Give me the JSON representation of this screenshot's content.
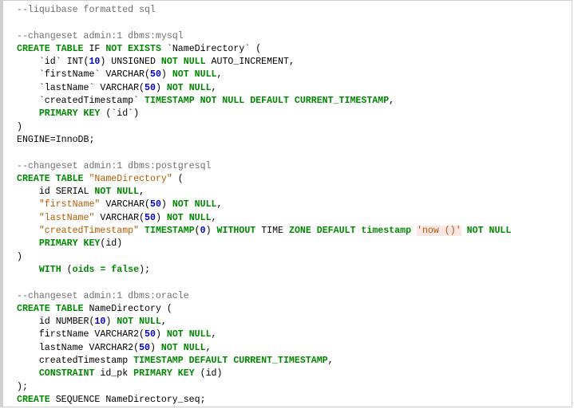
{
  "colors": {
    "keyword": "#008800",
    "comment": "#707070",
    "number": "#0000cc",
    "string": "#b35a00",
    "string_background": "#fbe5e5",
    "plain": "#000000",
    "frame_border": "#cfcfcf"
  },
  "code_lines": [
    [
      {
        "t": "--liquibase formatted sql",
        "k": "cm"
      }
    ],
    [],
    [
      {
        "t": "--changeset admin:1 dbms:mysql",
        "k": "cm"
      }
    ],
    [
      {
        "t": "CREATE TABLE",
        "k": "kw"
      },
      {
        "t": " IF ",
        "k": "pl"
      },
      {
        "t": "NOT EXISTS",
        "k": "kw"
      },
      {
        "t": " `NameDirectory` (",
        "k": "pl"
      }
    ],
    [
      {
        "t": "    `id` INT(",
        "k": "pl"
      },
      {
        "t": "10",
        "k": "num"
      },
      {
        "t": ") UNSIGNED ",
        "k": "pl"
      },
      {
        "t": "NOT NULL",
        "k": "kw"
      },
      {
        "t": " AUTO_INCREMENT,",
        "k": "pl"
      }
    ],
    [
      {
        "t": "    `firstName` VARCHAR(",
        "k": "pl"
      },
      {
        "t": "50",
        "k": "num"
      },
      {
        "t": ") ",
        "k": "pl"
      },
      {
        "t": "NOT NULL",
        "k": "kw"
      },
      {
        "t": ",",
        "k": "pl"
      }
    ],
    [
      {
        "t": "    `lastName` VARCHAR(",
        "k": "pl"
      },
      {
        "t": "50",
        "k": "num"
      },
      {
        "t": ") ",
        "k": "pl"
      },
      {
        "t": "NOT NULL",
        "k": "kw"
      },
      {
        "t": ",",
        "k": "pl"
      }
    ],
    [
      {
        "t": "    `createdTimestamp` ",
        "k": "pl"
      },
      {
        "t": "TIMESTAMP NOT NULL DEFAULT CURRENT_TIMESTAMP",
        "k": "kw"
      },
      {
        "t": ",",
        "k": "pl"
      }
    ],
    [
      {
        "t": "    ",
        "k": "pl"
      },
      {
        "t": "PRIMARY KEY",
        "k": "kw"
      },
      {
        "t": " (`id`)",
        "k": "pl"
      }
    ],
    [
      {
        "t": ")",
        "k": "pl"
      }
    ],
    [
      {
        "t": "ENGINE=InnoDB;",
        "k": "pl"
      }
    ],
    [],
    [
      {
        "t": "--changeset admin:1 dbms:postgresql",
        "k": "cm"
      }
    ],
    [
      {
        "t": "CREATE TABLE",
        "k": "kw"
      },
      {
        "t": " ",
        "k": "pl"
      },
      {
        "t": "\"NameDirectory\"",
        "k": "str"
      },
      {
        "t": " (",
        "k": "pl"
      }
    ],
    [
      {
        "t": "    id SERIAL ",
        "k": "pl"
      },
      {
        "t": "NOT NULL",
        "k": "kw"
      },
      {
        "t": ",",
        "k": "pl"
      }
    ],
    [
      {
        "t": "    ",
        "k": "pl"
      },
      {
        "t": "\"firstName\"",
        "k": "str"
      },
      {
        "t": " VARCHAR(",
        "k": "pl"
      },
      {
        "t": "50",
        "k": "num"
      },
      {
        "t": ") ",
        "k": "pl"
      },
      {
        "t": "NOT NULL",
        "k": "kw"
      },
      {
        "t": ",",
        "k": "pl"
      }
    ],
    [
      {
        "t": "    ",
        "k": "pl"
      },
      {
        "t": "\"lastName\"",
        "k": "str"
      },
      {
        "t": " VARCHAR(",
        "k": "pl"
      },
      {
        "t": "50",
        "k": "num"
      },
      {
        "t": ") ",
        "k": "pl"
      },
      {
        "t": "NOT NULL",
        "k": "kw"
      },
      {
        "t": ",",
        "k": "pl"
      }
    ],
    [
      {
        "t": "    ",
        "k": "pl"
      },
      {
        "t": "\"createdTimestamp\"",
        "k": "str"
      },
      {
        "t": " ",
        "k": "pl"
      },
      {
        "t": "TIMESTAMP",
        "k": "kw"
      },
      {
        "t": "(",
        "k": "pl"
      },
      {
        "t": "0",
        "k": "num"
      },
      {
        "t": ") ",
        "k": "pl"
      },
      {
        "t": "WITHOUT",
        "k": "kw"
      },
      {
        "t": " TIME ",
        "k": "pl"
      },
      {
        "t": "ZONE DEFAULT timestamp",
        "k": "kw"
      },
      {
        "t": " ",
        "k": "pl"
      },
      {
        "t": "'now ()'",
        "k": "strbg"
      },
      {
        "t": " ",
        "k": "pl"
      },
      {
        "t": "NOT NULL",
        "k": "kw"
      }
    ],
    [
      {
        "t": "    ",
        "k": "pl"
      },
      {
        "t": "PRIMARY KEY",
        "k": "kw"
      },
      {
        "t": "(id)",
        "k": "pl"
      }
    ],
    [
      {
        "t": ")",
        "k": "pl"
      }
    ],
    [
      {
        "t": "    ",
        "k": "pl"
      },
      {
        "t": "WITH",
        "k": "kw"
      },
      {
        "t": " (",
        "k": "pl"
      },
      {
        "t": "oids = false",
        "k": "kw"
      },
      {
        "t": ");",
        "k": "pl"
      }
    ],
    [],
    [
      {
        "t": "--changeset admin:1 dbms:oracle",
        "k": "cm"
      }
    ],
    [
      {
        "t": "CREATE TABLE",
        "k": "kw"
      },
      {
        "t": " NameDirectory (",
        "k": "pl"
      }
    ],
    [
      {
        "t": "    id NUMBER(",
        "k": "pl"
      },
      {
        "t": "10",
        "k": "num"
      },
      {
        "t": ") ",
        "k": "pl"
      },
      {
        "t": "NOT NULL",
        "k": "kw"
      },
      {
        "t": ",",
        "k": "pl"
      }
    ],
    [
      {
        "t": "    firstName VARCHAR2(",
        "k": "pl"
      },
      {
        "t": "50",
        "k": "num"
      },
      {
        "t": ") ",
        "k": "pl"
      },
      {
        "t": "NOT NULL",
        "k": "kw"
      },
      {
        "t": ",",
        "k": "pl"
      }
    ],
    [
      {
        "t": "    lastName VARCHAR2(",
        "k": "pl"
      },
      {
        "t": "50",
        "k": "num"
      },
      {
        "t": ") ",
        "k": "pl"
      },
      {
        "t": "NOT NULL",
        "k": "kw"
      },
      {
        "t": ",",
        "k": "pl"
      }
    ],
    [
      {
        "t": "    createdTimestamp ",
        "k": "pl"
      },
      {
        "t": "TIMESTAMP DEFAULT CURRENT_TIMESTAMP",
        "k": "kw"
      },
      {
        "t": ",",
        "k": "pl"
      }
    ],
    [
      {
        "t": "    ",
        "k": "pl"
      },
      {
        "t": "CONSTRAINT",
        "k": "kw"
      },
      {
        "t": " id_pk ",
        "k": "pl"
      },
      {
        "t": "PRIMARY KEY",
        "k": "kw"
      },
      {
        "t": " (id)",
        "k": "pl"
      }
    ],
    [
      {
        "t": ");",
        "k": "pl"
      }
    ],
    [
      {
        "t": "CREATE",
        "k": "kw"
      },
      {
        "t": " SEQUENCE NameDirectory_seq;",
        "k": "pl"
      }
    ]
  ]
}
